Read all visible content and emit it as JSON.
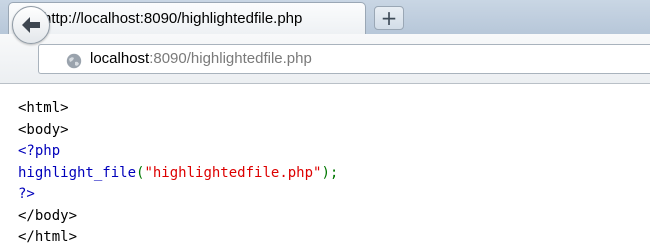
{
  "tab": {
    "title": "http://localhost:8090/highlightedfile.php",
    "favicon": "blank-page-icon"
  },
  "newtab": {
    "label": "+"
  },
  "navbar": {
    "back_icon": "arrow-left-icon",
    "site_icon": "globe-icon",
    "url_host": "localhost",
    "url_rest": ":8090/highlightedfile.php"
  },
  "page": {
    "lines": [
      [
        {
          "text": "<html>",
          "style": "html"
        }
      ],
      [
        {
          "text": "<body>",
          "style": "html"
        }
      ],
      [
        {
          "text": "<?php",
          "style": "default"
        }
      ],
      [
        {
          "text": "highlight_file",
          "style": "default"
        },
        {
          "text": "(",
          "style": "keyword"
        },
        {
          "text": "\"highlightedfile.php\"",
          "style": "string"
        },
        {
          "text": ");",
          "style": "keyword"
        }
      ],
      [
        {
          "text": "?>",
          "style": "default"
        }
      ],
      [
        {
          "text": "</body>",
          "style": "html"
        }
      ],
      [
        {
          "text": "</html>",
          "style": "html"
        }
      ]
    ],
    "colors": {
      "html": "#000000",
      "default": "#0000bb",
      "keyword": "#007700",
      "string": "#dd0000"
    }
  }
}
